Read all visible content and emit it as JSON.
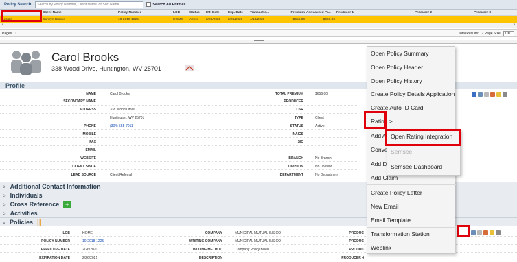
{
  "search": {
    "label": "Policy Search:",
    "placeholder": "Search by Policy Number, Client Name, or Sort Name.",
    "all_entities": "Search All Entities"
  },
  "grid": {
    "columns": [
      "Client Name",
      "Policy Number",
      "LOB",
      "Status",
      "Eff. Date",
      "Exp. Date",
      "Transactio...",
      "Premium",
      "Annualized Pr...",
      "Producer 1",
      "Producer 2",
      "Producer 3"
    ],
    "row": {
      "tag": "Results",
      "client": "Carolyn Brooks",
      "policy": "10-2018-1225",
      "lob": "HOME",
      "status": "Active",
      "eff": "2/26/2020",
      "exp": "2/26/2021",
      "trans": "4/13/2020",
      "premium": "$656.00",
      "annualized": "$656.00"
    }
  },
  "pager": {
    "pages": "Pages:",
    "page": "1",
    "total": "Total Results: 12 Page Size:",
    "size": "100"
  },
  "client": {
    "name": "Carol Brooks",
    "address": "338 Wood Drive, Huntington, WV 25701"
  },
  "profile": {
    "title": "Profile",
    "left": [
      {
        "label": "NAME",
        "value": "Carol Brooks"
      },
      {
        "label": "SECONDARY NAME",
        "value": ""
      },
      {
        "label": "ADDRESS",
        "value": "338 Wood Drive"
      },
      {
        "label": "",
        "value": "Huntington, WV 25701"
      },
      {
        "label": "PHONE",
        "value": "(304) 555-7911"
      },
      {
        "label": "MOBILE",
        "value": ""
      },
      {
        "label": "FAX",
        "value": ""
      },
      {
        "label": "EMAIL",
        "value": ""
      },
      {
        "label": "WEBSITE",
        "value": ""
      },
      {
        "label": "CLIENT SINCE",
        "value": ""
      },
      {
        "label": "LEAD SOURCE",
        "value": "Client Referral"
      }
    ],
    "right": [
      {
        "label": "TOTAL PREMIUM",
        "value": "$656.00"
      },
      {
        "label": "PRODUCER",
        "value": ""
      },
      {
        "label": "CSR",
        "value": ""
      },
      {
        "label": "TYPE",
        "value": "Client"
      },
      {
        "label": "STATUS",
        "value": "Active"
      },
      {
        "label": "NAICS",
        "value": ""
      },
      {
        "label": "SIC",
        "value": ""
      },
      {
        "label": "",
        "value": ""
      },
      {
        "label": "BRANCH",
        "value": "No Branch"
      },
      {
        "label": "DIVISION",
        "value": "No Division"
      },
      {
        "label": "DEPARTMENT",
        "value": "No Department"
      }
    ]
  },
  "sections": [
    "Additional Contact Information",
    "Individuals",
    "Cross Reference",
    "Activities",
    "Policies"
  ],
  "policy": {
    "rows": [
      {
        "l1": "LOB",
        "v1": "HOME",
        "l2": "COMPANY",
        "v2": "MUNICIPAL MUTUAL INS CO",
        "l3": "PRODUC"
      },
      {
        "l1": "POLICY NUMBER",
        "v1": "10-2018-1225",
        "l2": "WRITING COMPANY",
        "v2": "MUNICIPAL MUTUAL INS CO",
        "l3": "PRODUC"
      },
      {
        "l1": "EFFECTIVE DATE",
        "v1": "2/26/2020",
        "l2": "BILLING METHOD",
        "v2": "Company Policy Billed",
        "l3": "PRODUC"
      },
      {
        "l1": "EXPIRATION DATE",
        "v1": "2/26/2021",
        "l2": "DESCRIPTION",
        "v2": "",
        "l3": "PRODUCER 4"
      }
    ]
  },
  "menu": {
    "items": [
      "Open Policy Summary",
      "Open Policy Header",
      "Open Policy History",
      "Create Policy Details Application",
      "Create Auto ID Card",
      "Rating >",
      "Add A",
      "Conve",
      "Add Di",
      "Add Claim",
      "Create Policy Letter",
      "New Email",
      "Email Template",
      "Transformation Station",
      "Weblink"
    ]
  },
  "submenu": {
    "items": [
      "Open Rating Integration",
      "Semsee",
      "Semsee Dashboard"
    ]
  },
  "colors": {
    "highlight": "#ffc400",
    "red": "#e0000b"
  }
}
